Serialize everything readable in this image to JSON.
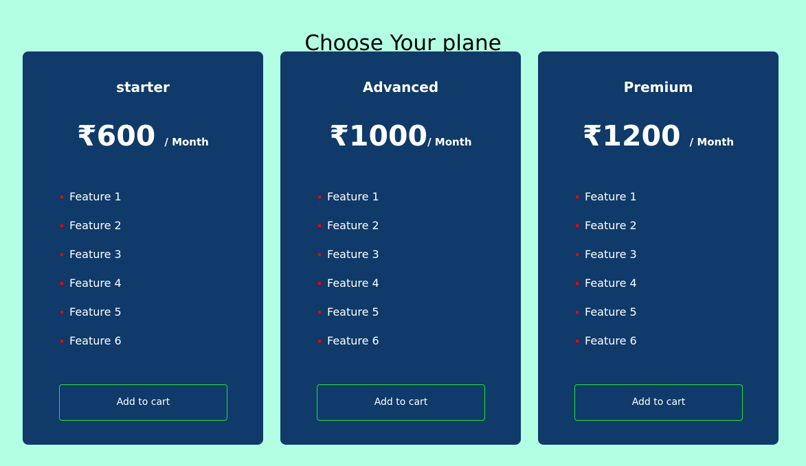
{
  "page": {
    "title": "Choose Your plane"
  },
  "plans": [
    {
      "name": "starter",
      "price": "₹600",
      "period": "/ Month",
      "features": [
        "Feature 1",
        "Feature 2",
        "Feature 3",
        "Feature 4",
        "Feature 5",
        "Feature 6"
      ],
      "button_label": "Add to cart"
    },
    {
      "name": "Advanced",
      "price": "₹1000",
      "period": "/ Month",
      "features": [
        "Feature 1",
        "Feature 2",
        "Feature 3",
        "Feature 4",
        "Feature 5",
        "Feature 6"
      ],
      "button_label": "Add to cart"
    },
    {
      "name": "Premium",
      "price": "₹1200",
      "period": "/ Month",
      "features": [
        "Feature 1",
        "Feature 2",
        "Feature 3",
        "Feature 4",
        "Feature 5",
        "Feature 6"
      ],
      "button_label": "Add to cart"
    }
  ],
  "colors": {
    "background": "#b3ffe4",
    "card": "#0f3a69",
    "bullet": "#ff0000",
    "button_border": "#1ee43a",
    "text_on_card": "#ffffff"
  }
}
